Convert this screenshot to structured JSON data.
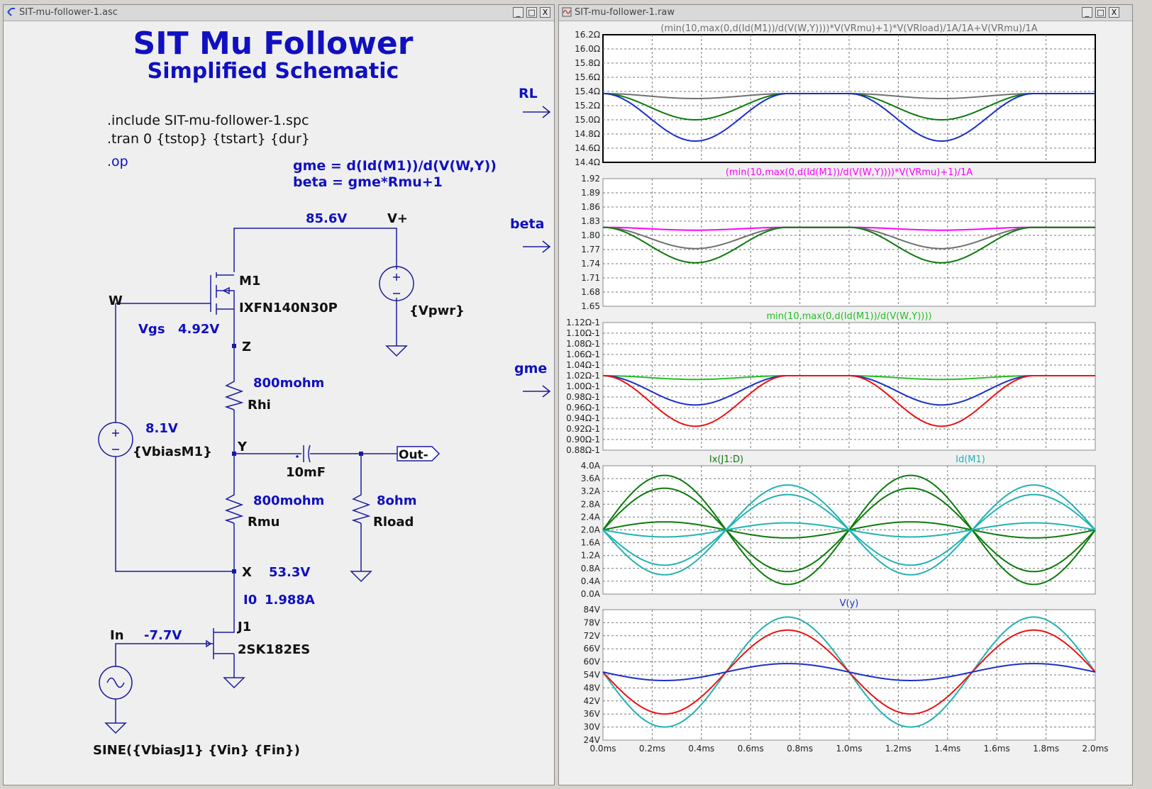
{
  "schematic_window": {
    "title": "SIT-mu-follower-1.asc",
    "buttons": {
      "minimize": "_",
      "maximize": "□",
      "close": "X"
    }
  },
  "plot_window": {
    "title": "SIT-mu-follower-1.raw",
    "buttons": {
      "minimize": "_",
      "maximize": "□",
      "close": "X"
    }
  },
  "schematic": {
    "title": "SIT Mu Follower",
    "subtitle": "Simplified Schematic",
    "directives": [
      ".include SIT-mu-follower-1.spc",
      ".tran 0 {tstop} {tstart} {dur}"
    ],
    "op": ".op",
    "params": [
      "gme = d(Id(M1))/d(V(W,Y))",
      "beta = gme*Rmu+1"
    ],
    "arrow_labels": {
      "rl": "RL",
      "beta": "beta",
      "gme": "gme"
    },
    "labels": {
      "vplus_voltage": "85.6V",
      "vplus": "V+",
      "m1_name": "M1",
      "m1_model": "IXFN140N30P",
      "w": "W",
      "vgs_label": "Vgs",
      "vgs_value": "4.92V",
      "vpwr": "{Vpwr}",
      "z": "Z",
      "rhi_value": "800mohm",
      "rhi_name": "Rhi",
      "vbias_value": "8.1V",
      "vbias_name": "{VbiasM1}",
      "y": "Y",
      "cap_value": "10mF",
      "out": "Out-",
      "rmu_value": "800mohm",
      "rmu_name": "Rmu",
      "rload_value": "8ohm",
      "rload_name": "Rload",
      "x": "X",
      "x_voltage": "53.3V",
      "i0_label": "I0",
      "i0_value": "1.988A",
      "j1_name": "J1",
      "j1_model": "2SK182ES",
      "in": "In",
      "in_voltage": "-7.7V",
      "sine": "SINE({VbiasJ1} {Vin} {Fin})"
    }
  },
  "colors": {
    "schematic_blue": "#1010c0",
    "wire": "#1a1aa0",
    "dark_green": "#0c7a0c",
    "blue": "#1a2fc8",
    "gray": "#707070",
    "magenta": "#ff00ff",
    "green": "#22c022",
    "red": "#ee1111",
    "teal": "#22b2b2",
    "plot_bg": "#ffffff"
  },
  "chart_data": [
    {
      "type": "line",
      "title": "(min(10,max(0,d(Id(M1))/d(V(W,Y))))*V(VRmu)+1)*V(VRload)/1A/1A+V(VRmu)/1A",
      "title_color": "gray",
      "y_ticks": [
        "16.2Ω",
        "16.0Ω",
        "15.8Ω",
        "15.6Ω",
        "15.4Ω",
        "15.2Ω",
        "15.0Ω",
        "14.8Ω",
        "14.6Ω",
        "14.4Ω"
      ],
      "ylim": [
        14.4,
        16.2
      ],
      "x_unit": "ms",
      "series": [
        {
          "color": "gray",
          "shape": "gme",
          "center": 15.37,
          "dip": 0.07,
          "spike": 0.3
        },
        {
          "color": "dark_green",
          "shape": "gme",
          "center": 15.37,
          "dip": 0.37,
          "spike": 0.4
        },
        {
          "color": "blue",
          "shape": "gme",
          "center": 15.37,
          "dip": 0.67,
          "spike": 1.0
        }
      ]
    },
    {
      "type": "line",
      "title": "(min(10,max(0,d(Id(M1))/d(V(W,Y))))*V(VRmu)+1)/1A",
      "title_color": "magenta",
      "y_ticks": [
        "1.92",
        "1.89",
        "1.86",
        "1.83",
        "1.80",
        "1.77",
        "1.74",
        "1.71",
        "1.68",
        "1.65"
      ],
      "ylim": [
        1.65,
        1.92
      ],
      "x_unit": "ms",
      "series": [
        {
          "color": "magenta",
          "shape": "gme",
          "center": 1.817,
          "dip": 0.006,
          "spike": 0.04
        },
        {
          "color": "gray",
          "shape": "gme",
          "center": 1.817,
          "dip": 0.045,
          "spike": 0.06
        },
        {
          "color": "dark_green",
          "shape": "gme",
          "center": 1.817,
          "dip": 0.075,
          "spike": 0.12
        }
      ]
    },
    {
      "type": "line",
      "title": "min(10,max(0,d(Id(M1))/d(V(W,Y))))",
      "title_color": "green",
      "y_ticks": [
        "1.12Ω-1",
        "1.10Ω-1",
        "1.08Ω-1",
        "1.06Ω-1",
        "1.04Ω-1",
        "1.02Ω-1",
        "1.00Ω-1",
        "0.98Ω-1",
        "0.96Ω-1",
        "0.94Ω-1",
        "0.92Ω-1",
        "0.90Ω-1",
        "0.88Ω-1"
      ],
      "ylim": [
        0.88,
        1.12
      ],
      "x_unit": "ms",
      "series": [
        {
          "color": "green",
          "shape": "gme",
          "center": 1.02,
          "dip": 0.007,
          "spike": 0.04
        },
        {
          "color": "blue",
          "shape": "gme",
          "center": 1.02,
          "dip": 0.055,
          "spike": 0.08
        },
        {
          "color": "red",
          "shape": "gme",
          "center": 1.02,
          "dip": 0.095,
          "spike": 0.11
        }
      ]
    },
    {
      "type": "line",
      "title_left": "Ix(J1:D)",
      "title_left_color": "dark_green",
      "title_right": "Id(M1)",
      "title_right_color": "teal",
      "y_ticks": [
        "4.0A",
        "3.6A",
        "3.2A",
        "2.8A",
        "2.4A",
        "2.0A",
        "1.6A",
        "1.2A",
        "0.8A",
        "0.4A",
        "0.0A"
      ],
      "ylim": [
        0,
        4.0
      ],
      "x_unit": "ms",
      "series": [
        {
          "color": "dark_green",
          "shape": "sin",
          "offset": 2.0,
          "amp": 1.7
        },
        {
          "color": "dark_green",
          "shape": "sin",
          "offset": 2.0,
          "amp": 1.3
        },
        {
          "color": "dark_green",
          "shape": "sin",
          "offset": 2.0,
          "amp": 0.25
        },
        {
          "color": "teal",
          "shape": "sin",
          "offset": 2.0,
          "amp": -1.4
        },
        {
          "color": "teal",
          "shape": "sin",
          "offset": 2.0,
          "amp": -1.1
        },
        {
          "color": "teal",
          "shape": "sin",
          "offset": 2.0,
          "amp": -0.22
        }
      ]
    },
    {
      "type": "line",
      "title": "V(y)",
      "title_color": "blue",
      "y_ticks": [
        "84V",
        "78V",
        "72V",
        "66V",
        "60V",
        "54V",
        "48V",
        "42V",
        "36V",
        "30V",
        "24V"
      ],
      "ylim": [
        24,
        84
      ],
      "x_ticks": [
        "0.0ms",
        "0.2ms",
        "0.4ms",
        "0.6ms",
        "0.8ms",
        "1.0ms",
        "1.2ms",
        "1.4ms",
        "1.6ms",
        "1.8ms",
        "2.0ms"
      ],
      "x_range": [
        0,
        2.0
      ],
      "x_unit": "ms",
      "series": [
        {
          "color": "teal",
          "shape": "sin",
          "offset": 55.3,
          "amp": -25.3
        },
        {
          "color": "red",
          "shape": "sin",
          "offset": 55.3,
          "amp": -19.3
        },
        {
          "color": "blue",
          "shape": "sin",
          "offset": 55.3,
          "amp": -3.9
        }
      ]
    }
  ]
}
